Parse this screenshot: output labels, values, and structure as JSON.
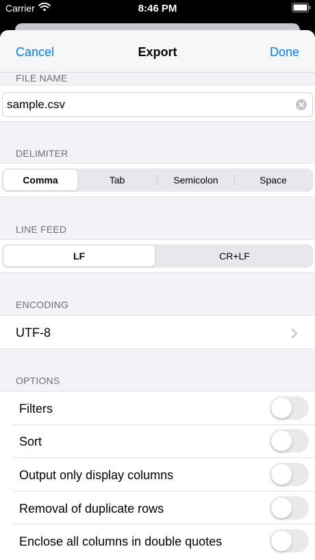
{
  "status_bar": {
    "carrier": "Carrier",
    "time": "8:46 PM"
  },
  "nav": {
    "cancel": "Cancel",
    "title": "Export",
    "done": "Done",
    "accent_color": "#007aff"
  },
  "file_name": {
    "header": "FILE NAME",
    "value": "sample.csv"
  },
  "delimiter": {
    "header": "DELIMITER",
    "options": [
      "Comma",
      "Tab",
      "Semicolon",
      "Space"
    ],
    "selected": "Comma"
  },
  "line_feed": {
    "header": "LINE FEED",
    "options": [
      "LF",
      "CR+LF"
    ],
    "selected": "LF"
  },
  "encoding": {
    "header": "ENCODING",
    "value": "UTF-8"
  },
  "options": {
    "header": "OPTIONS",
    "items": [
      {
        "label": "Filters",
        "on": false
      },
      {
        "label": "Sort",
        "on": false
      },
      {
        "label": "Output only display columns",
        "on": false
      },
      {
        "label": "Removal of duplicate rows",
        "on": false
      },
      {
        "label": "Enclose all columns in double quotes",
        "on": false
      }
    ]
  }
}
